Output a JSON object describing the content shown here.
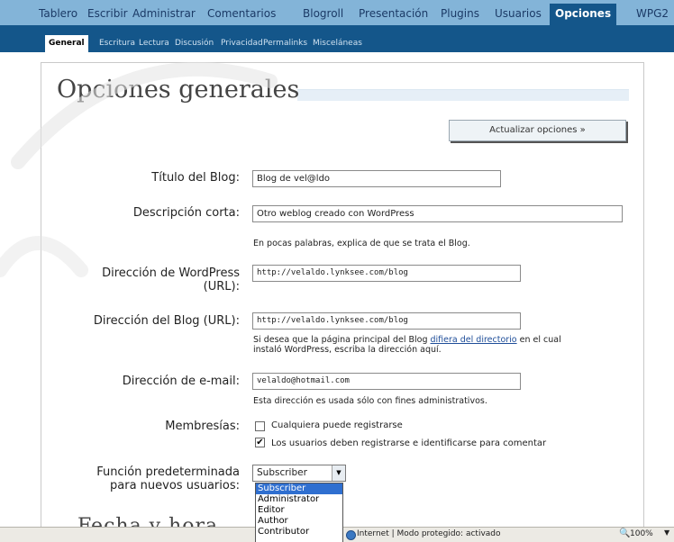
{
  "topnav": {
    "items": [
      "Tablero",
      "Escribir",
      "Administrar",
      "Comentarios",
      "Blogroll",
      "Presentación",
      "Plugins",
      "Usuarios",
      "Opciones",
      "WPG2"
    ],
    "active": "Opciones"
  },
  "subnav": {
    "items": [
      "General",
      "Escritura",
      "Lectura",
      "Discusión",
      "Privacidad",
      "Permalinks",
      "Misceláneas"
    ],
    "active": "General"
  },
  "page_title": "Opciones generales",
  "update_button": "Actualizar opciones »",
  "form": {
    "blog_title": {
      "label": "Título del Blog:",
      "value": "Blog de vel@ldo"
    },
    "tagline": {
      "label": "Descripción corta:",
      "value": "Otro weblog creado con WordPress",
      "help": "En pocas palabras, explica de que se trata el Blog."
    },
    "wp_url": {
      "label_line1": "Dirección de WordPress",
      "label_line2": "(URL):",
      "value": "http://velaldo.lynksee.com/blog"
    },
    "blog_url": {
      "label": "Dirección del Blog (URL):",
      "value": "http://velaldo.lynksee.com/blog",
      "help_before": "Si desea que la página principal del Blog ",
      "help_link": "difiera del directorio",
      "help_after": " en el cual",
      "help_line2": "instaló WordPress, escriba la dirección aquí."
    },
    "email": {
      "label": "Dirección de e-mail:",
      "value": "velaldo@hotmail.com",
      "help": "Esta dirección es usada sólo con fines administrativos."
    },
    "membership": {
      "label": "Membresías:",
      "anyone_register": {
        "label": "Cualquiera puede registrarse",
        "checked": false
      },
      "must_login": {
        "label": "Los usuarios deben registrarse e identificarse para comentar",
        "checked": true
      }
    },
    "default_role": {
      "label_line1": "Función predeterminada",
      "label_line2": "para nuevos usuarios:",
      "selected": "Subscriber",
      "options": [
        "Subscriber",
        "Administrator",
        "Editor",
        "Author",
        "Contributor"
      ]
    }
  },
  "section_heading": "Fecha y hora",
  "statusbar": {
    "zone": "Internet | Modo protegido: activado",
    "zoom": "100%"
  },
  "colors": {
    "topnav_bg": "#83b4d8",
    "subnav_bg": "#14568a",
    "link": "#1f4e99",
    "dropdown_selected": "#2f6fd0"
  }
}
